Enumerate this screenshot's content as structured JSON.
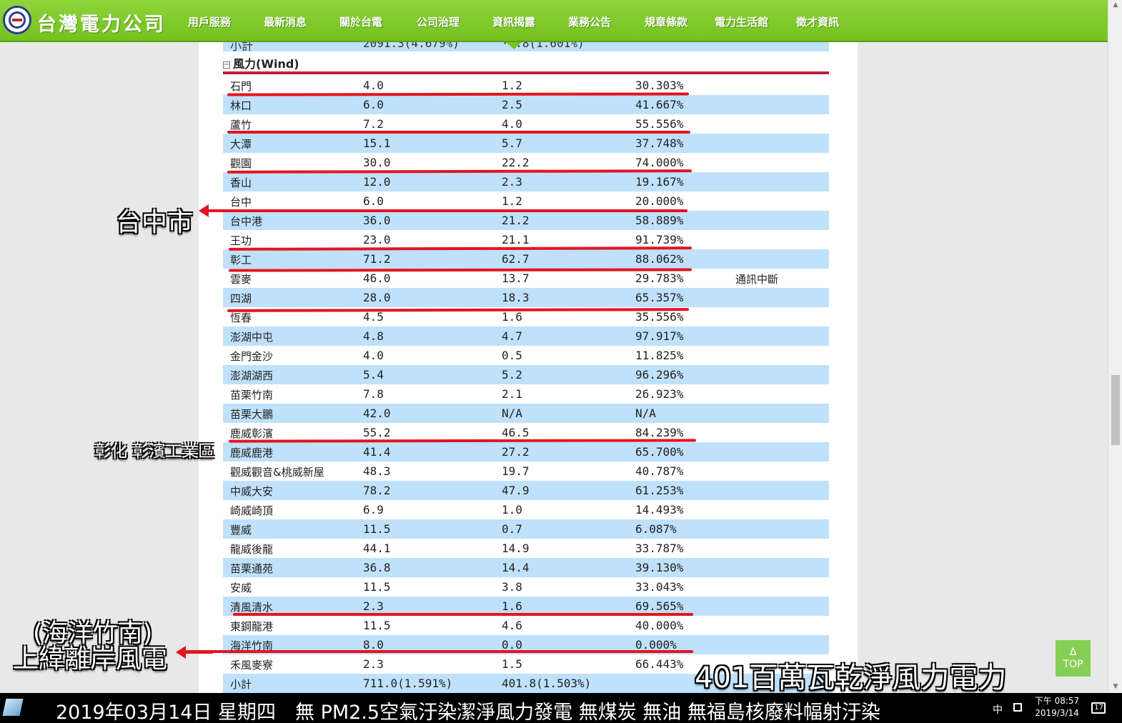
{
  "header": {
    "logo_text": "台灣電力公司",
    "nav": [
      "用戶服務",
      "最新消息",
      "關於台電",
      "公司治理",
      "資訊揭露",
      "業務公告",
      "規章條款",
      "電力生活館",
      "徵才資訊"
    ]
  },
  "previous_subtotal": {
    "label": "小計",
    "capacity": "2091.3(4.679%)",
    "output": "··.8(1.601%)"
  },
  "section": {
    "toggle": "⊟",
    "title": "風力(Wind)"
  },
  "rows": [
    {
      "name": "石門",
      "capacity": "4.0",
      "output": "1.2",
      "percent": "30.303%",
      "note": ""
    },
    {
      "name": "林口",
      "capacity": "6.0",
      "output": "2.5",
      "percent": "41.667%",
      "note": ""
    },
    {
      "name": "蘆竹",
      "capacity": "7.2",
      "output": "4.0",
      "percent": "55.556%",
      "note": ""
    },
    {
      "name": "大潭",
      "capacity": "15.1",
      "output": "5.7",
      "percent": "37.748%",
      "note": ""
    },
    {
      "name": "觀園",
      "capacity": "30.0",
      "output": "22.2",
      "percent": "74.000%",
      "note": ""
    },
    {
      "name": "香山",
      "capacity": "12.0",
      "output": "2.3",
      "percent": "19.167%",
      "note": ""
    },
    {
      "name": "台中",
      "capacity": "6.0",
      "output": "1.2",
      "percent": "20.000%",
      "note": ""
    },
    {
      "name": "台中港",
      "capacity": "36.0",
      "output": "21.2",
      "percent": "58.889%",
      "note": ""
    },
    {
      "name": "王功",
      "capacity": "23.0",
      "output": "21.1",
      "percent": "91.739%",
      "note": ""
    },
    {
      "name": "彰工",
      "capacity": "71.2",
      "output": "62.7",
      "percent": "88.062%",
      "note": ""
    },
    {
      "name": "雲麥",
      "capacity": "46.0",
      "output": "13.7",
      "percent": "29.783%",
      "note": "通訊中斷"
    },
    {
      "name": "四湖",
      "capacity": "28.0",
      "output": "18.3",
      "percent": "65.357%",
      "note": ""
    },
    {
      "name": "恆春",
      "capacity": "4.5",
      "output": "1.6",
      "percent": "35.556%",
      "note": ""
    },
    {
      "name": "澎湖中屯",
      "capacity": "4.8",
      "output": "4.7",
      "percent": "97.917%",
      "note": ""
    },
    {
      "name": "金門金沙",
      "capacity": "4.0",
      "output": "0.5",
      "percent": "11.825%",
      "note": ""
    },
    {
      "name": "澎湖湖西",
      "capacity": "5.4",
      "output": "5.2",
      "percent": "96.296%",
      "note": ""
    },
    {
      "name": "苗栗竹南",
      "capacity": "7.8",
      "output": "2.1",
      "percent": "26.923%",
      "note": ""
    },
    {
      "name": "苗栗大鵬",
      "capacity": "42.0",
      "output": "N/A",
      "percent": "N/A",
      "note": ""
    },
    {
      "name": "鹿威彰濱",
      "capacity": "55.2",
      "output": "46.5",
      "percent": "84.239%",
      "note": ""
    },
    {
      "name": "鹿威鹿港",
      "capacity": "41.4",
      "output": "27.2",
      "percent": "65.700%",
      "note": ""
    },
    {
      "name": "觀威觀音&桃威新屋",
      "capacity": "48.3",
      "output": "19.7",
      "percent": "40.787%",
      "note": ""
    },
    {
      "name": "中威大安",
      "capacity": "78.2",
      "output": "47.9",
      "percent": "61.253%",
      "note": ""
    },
    {
      "name": "崎威崎頂",
      "capacity": "6.9",
      "output": "1.0",
      "percent": "14.493%",
      "note": ""
    },
    {
      "name": "豐威",
      "capacity": "11.5",
      "output": "0.7",
      "percent": "6.087%",
      "note": ""
    },
    {
      "name": "龍威後龍",
      "capacity": "44.1",
      "output": "14.9",
      "percent": "33.787%",
      "note": ""
    },
    {
      "name": "苗栗通苑",
      "capacity": "36.8",
      "output": "14.4",
      "percent": "39.130%",
      "note": ""
    },
    {
      "name": "安威",
      "capacity": "11.5",
      "output": "3.8",
      "percent": "33.043%",
      "note": ""
    },
    {
      "name": "清風清水",
      "capacity": "2.3",
      "output": "1.6",
      "percent": "69.565%",
      "note": ""
    },
    {
      "name": "東鋼龍港",
      "capacity": "11.5",
      "output": "4.6",
      "percent": "40.000%",
      "note": ""
    },
    {
      "name": "海洋竹南",
      "capacity": "8.0",
      "output": "0.0",
      "percent": "0.000%",
      "note": ""
    },
    {
      "name": "禾風麥寮",
      "capacity": "2.3",
      "output": "1.5",
      "percent": "66.443%",
      "note": ""
    },
    {
      "name": "小計",
      "capacity": "711.0(1.591%)",
      "output": "401.8(1.503%)",
      "percent": "",
      "note": ""
    }
  ],
  "annotations": {
    "taichung": "台中市",
    "changhua": "彰化 彰濱工業區",
    "offshore_line1": "(海洋竹南)",
    "offshore_line2": "上緯離岸風電",
    "total": "401百萬瓦乾淨風力電力"
  },
  "top_button": {
    "arrow": "Δ",
    "label": "TOP"
  },
  "taskbar": {
    "ticker": "2019年03月14日 星期四　無 PM2.5空氣汙染潔淨風力發電 無煤炭 無油 無福島核廢料幅射汙染",
    "ime": "中",
    "time": "下午 08:57",
    "date": "2019/3/14",
    "notifications": "17"
  },
  "colors": {
    "header_green": "#74c21f",
    "row_alt": "#bfe1fb",
    "section_rule": "#bd1d3b",
    "annotation_red": "#e3151e"
  }
}
